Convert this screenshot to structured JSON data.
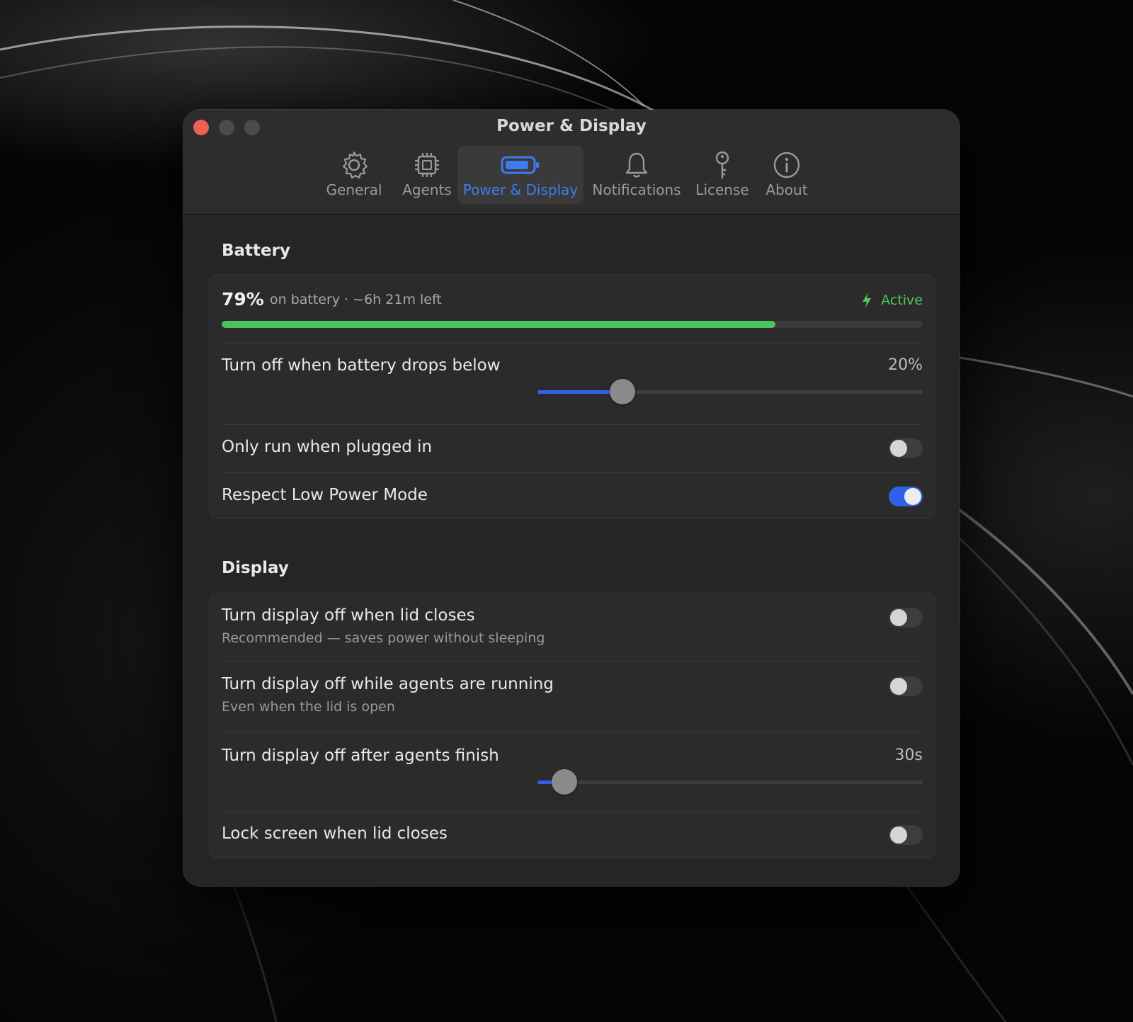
{
  "window": {
    "title": "Power & Display"
  },
  "tabs": [
    {
      "label": "General",
      "icon": "gear-icon"
    },
    {
      "label": "Agents",
      "icon": "cpu-icon"
    },
    {
      "label": "Power & Display",
      "icon": "battery-icon",
      "active": true
    },
    {
      "label": "Notifications",
      "icon": "bell-icon"
    },
    {
      "label": "License",
      "icon": "key-icon"
    },
    {
      "label": "About",
      "icon": "info-icon"
    }
  ],
  "battery": {
    "section_title": "Battery",
    "percent_label": "79%",
    "level": 0.79,
    "info": "on battery · ~6h 21m left",
    "status": "Active",
    "status_color": "#4ec75a",
    "turn_off": {
      "label": "Turn off when battery drops below",
      "value": "20%",
      "slider_fraction": 0.22
    },
    "only_plugged": {
      "label": "Only run when plugged in",
      "on": false
    },
    "low_power": {
      "label": "Respect Low Power Mode",
      "on": true
    }
  },
  "display": {
    "section_title": "Display",
    "lid_off": {
      "label": "Turn display off when lid closes",
      "sub": "Recommended — saves power without sleeping",
      "on": false
    },
    "agents_running": {
      "label": "Turn display off while agents are running",
      "sub": "Even when the lid is open",
      "on": false
    },
    "after_finish": {
      "label": "Turn display off after agents finish",
      "value": "30s",
      "slider_fraction": 0.07
    },
    "lock_screen": {
      "label": "Lock screen when lid closes",
      "on": false
    }
  },
  "colors": {
    "accent": "#2f62e8",
    "battery_fill": "#4cc35a",
    "close": "#ee5f55"
  }
}
